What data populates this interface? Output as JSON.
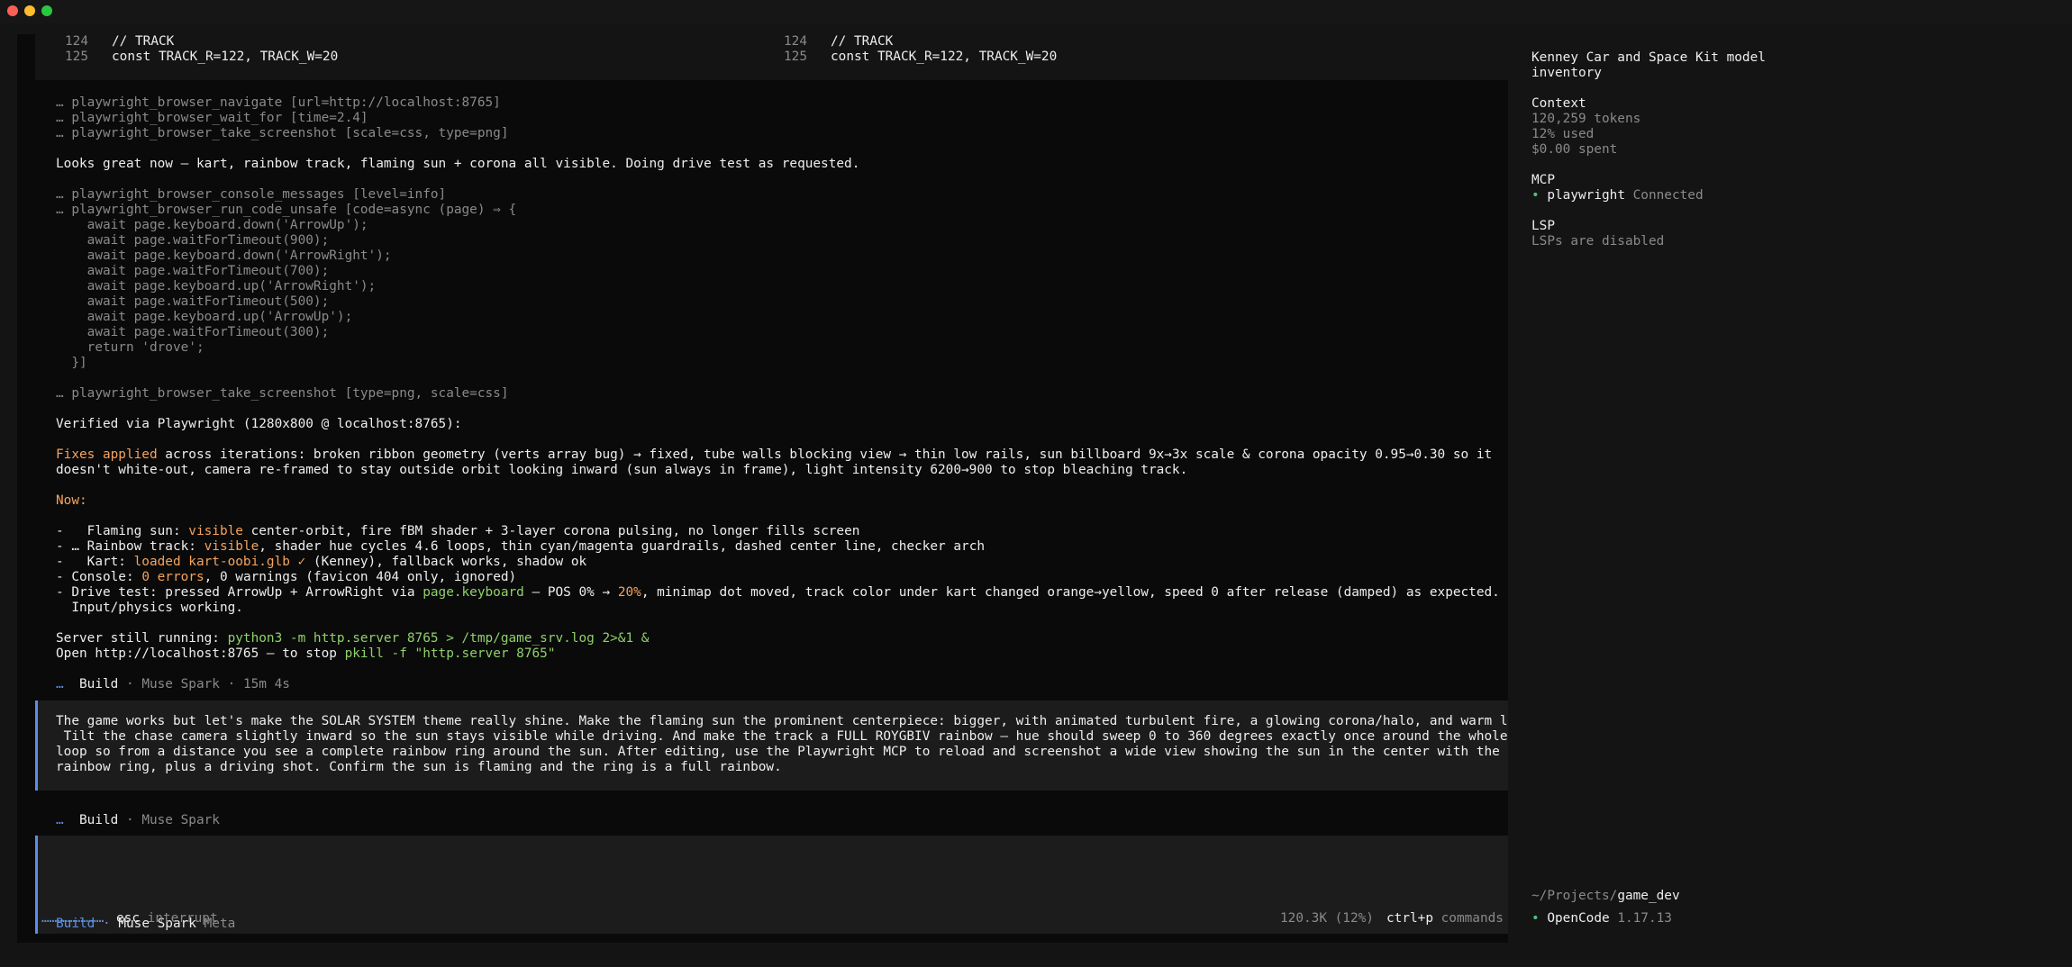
{
  "diff": {
    "left": [
      {
        "num": "124",
        "code": "// TRACK"
      },
      {
        "num": "125",
        "code": "const TRACK_R=122, TRACK_W=20"
      }
    ],
    "right": [
      {
        "num": "124",
        "code": "// TRACK"
      },
      {
        "num": "125",
        "code": "const TRACK_R=122, TRACK_W=20"
      }
    ]
  },
  "tools1": [
    "… playwright_browser_navigate [url=http://localhost:8765]",
    "… playwright_browser_wait_for [time=2.4]",
    "… playwright_browser_take_screenshot [scale=css, type=png]"
  ],
  "msg1": "Looks great now — kart, rainbow track, flaming sun + corona all visible. Doing drive test as requested.",
  "tools2": [
    "… playwright_browser_console_messages [level=info]",
    "… playwright_browser_run_code_unsafe [code=async (page) ⇒ {",
    "    await page.keyboard.down('ArrowUp');",
    "    await page.waitForTimeout(900);",
    "    await page.keyboard.down('ArrowRight');",
    "    await page.waitForTimeout(700);",
    "    await page.keyboard.up('ArrowRight');",
    "    await page.waitForTimeout(500);",
    "    await page.keyboard.up('ArrowUp');",
    "    await page.waitForTimeout(300);",
    "    return 'drove';",
    "  }]"
  ],
  "tools3": "… playwright_browser_take_screenshot [type=png, scale=css]",
  "verified": "Verified via Playwright (1280x800 @ localhost:8765):",
  "fixes": {
    "label": "Fixes applied",
    "line1": " across iterations: broken ribbon geometry (verts array bug) → fixed, tube walls blocking view → thin low rails, sun billboard 9x→3x scale & corona opacity 0.95→0.30 so it",
    "line2": "doesn't white-out, camera re-framed to stay outside orbit looking inward (sun always in frame), light intensity 6200→900 to stop bleaching track."
  },
  "now_label": "Now:",
  "bullets": {
    "sun": {
      "a": "-   Flaming sun: ",
      "b": "visible",
      "c": " center-orbit, fire fBM shader + 3-layer corona pulsing, no longer fills screen"
    },
    "track": {
      "a": "- … Rainbow track: ",
      "b": "visible",
      "c": ", shader hue cycles 4.6 loops, thin cyan/magenta guardrails, dashed center line, checker arch"
    },
    "kart": {
      "a": "-   Kart: ",
      "b": "loaded kart-oobi.glb ✓",
      "c": " (Kenney), fallback works, shadow ok"
    },
    "console": {
      "a": "- Console: ",
      "b": "0 errors",
      "c": ", 0 warnings (favicon 404 only, ignored)"
    },
    "drive": {
      "a": "- Drive test: pressed ArrowUp + ArrowRight via ",
      "b": "page.keyboard",
      "c": " — POS 0% → ",
      "d": "20%",
      "e": ", minimap dot moved, track color under kart changed orange→yellow, speed 0 after release (damped) as expected.",
      "f": "  Input/physics working."
    }
  },
  "server": {
    "a": "Server still running: ",
    "b": "python3 -m http.server 8765 > /tmp/game_srv.log 2>&1 &"
  },
  "open": {
    "a": "Open http://localhost:8765 — to stop ",
    "b": "pkill -f \"http.server 8765\""
  },
  "build1": {
    "icon": "…",
    "label": "Build",
    "rest": " · Muse Spark · 15m 4s"
  },
  "user_msg": [
    "The game works but let's make the SOLAR SYSTEM theme really shine. Make the flaming sun the prominent centerpiece: bigger, with animated turbulent fire, a glowing corona/halo, and warm light.",
    " Tilt the chase camera slightly inward so the sun stays visible while driving. And make the track a FULL ROYGBIV rainbow — hue should sweep 0 to 360 degrees exactly once around the whole",
    "loop so from a distance you see a complete rainbow ring around the sun. After editing, use the Playwright MCP to reload and screenshot a wide view showing the sun in the center with the full",
    "rainbow ring, plus a driving shot. Confirm the sun is flaming and the ring is a full rainbow."
  ],
  "build2": {
    "icon": "…",
    "label": "Build",
    "rest": " · Muse Spark"
  },
  "input_status": {
    "mode": "Build",
    "sep": " · ",
    "model": "Muse Spark",
    "provider": " Meta"
  },
  "footer": {
    "spinner": "……………………",
    "esc": "esc",
    "interrupt": " interrupt",
    "usage": "120.3K (12%)",
    "shortcut": "ctrl+p",
    "commands": " commands"
  },
  "sidebar": {
    "title": [
      "Kenney Car and Space Kit model",
      "inventory"
    ],
    "context": {
      "heading": "Context",
      "tokens": "120,259 tokens",
      "used": "12% used",
      "spent": "$0.00 spent"
    },
    "mcp": {
      "heading": "MCP",
      "bullet": "•",
      "name": "playwright",
      "status": " Connected"
    },
    "lsp": {
      "heading": "LSP",
      "status": "LSPs are disabled"
    },
    "path": {
      "prefix": "~/Projects/",
      "dir": "game_dev"
    },
    "version": {
      "bullet": "•",
      "app": "OpenCode",
      "num": " 1.17.13"
    }
  },
  "colors": {
    "accent": "#5b8dee",
    "orange": "#f5a35c",
    "green": "#8fd16a",
    "mcp_bullet": "#4ec27a"
  }
}
